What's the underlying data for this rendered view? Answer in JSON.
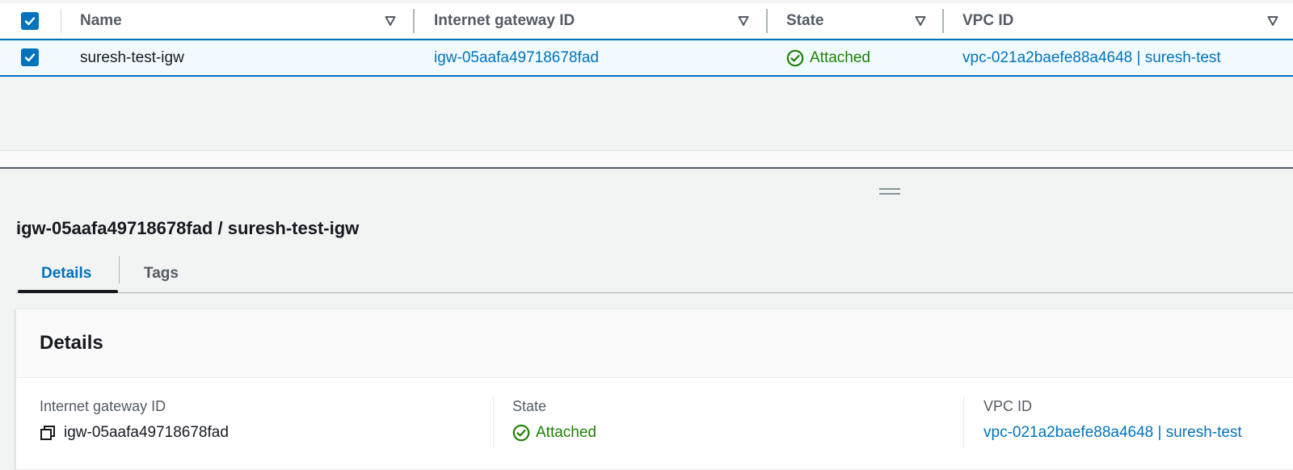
{
  "table": {
    "columns": [
      {
        "label": "Name"
      },
      {
        "label": "Internet gateway ID"
      },
      {
        "label": "State"
      },
      {
        "label": "VPC ID"
      }
    ],
    "rows": [
      {
        "selected": true,
        "name": "suresh-test-igw",
        "igw_id": "igw-05aafa49718678fad",
        "state": "Attached",
        "vpc_id": "vpc-021a2baefe88a4648 | suresh-test"
      }
    ]
  },
  "detail": {
    "title": "igw-05aafa49718678fad / suresh-test-igw",
    "tabs": [
      {
        "label": "Details",
        "active": true
      },
      {
        "label": "Tags",
        "active": false
      }
    ],
    "card": {
      "title": "Details",
      "fields": [
        {
          "label": "Internet gateway ID",
          "value": "igw-05aafa49718678fad",
          "icon": "copy-icon"
        },
        {
          "label": "State",
          "value": "Attached",
          "icon": "check-circle-icon"
        },
        {
          "label": "VPC ID",
          "value": "vpc-021a2baefe88a4648 | suresh-test"
        }
      ]
    }
  },
  "colors": {
    "link": "#0073bb",
    "success": "#1d8102",
    "selected_row_bg": "#f1faff",
    "accent": "#0073bb"
  }
}
